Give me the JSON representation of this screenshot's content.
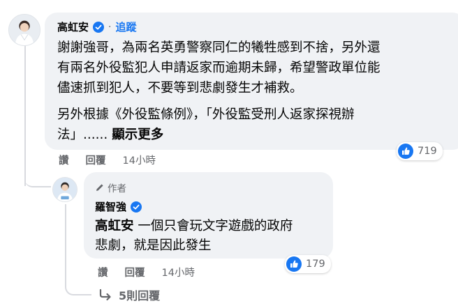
{
  "comment": {
    "author": "高虹安",
    "separator": "·",
    "follow_label": "追蹤",
    "text_lines": [
      "謝謝強哥，為兩名英勇警察同仁的犧牲感到不捨，另外還",
      "有兩名外役監犯人申請返家而逾期未歸，希望警政單位能",
      "儘速抓到犯人，不要等到悲劇發生才補救。"
    ],
    "text_lines_2": [
      "另外根據《外役監條例》，「外役監受刑人返家探視辦",
      "法」......"
    ],
    "see_more": "顯示更多",
    "actions": {
      "like": "讚",
      "reply": "回覆",
      "time": "14小時"
    },
    "reaction_count": "719"
  },
  "reply": {
    "author_badge": "作者",
    "author": "羅智強",
    "mention": "高虹安",
    "text_lines": [
      " 一個只會玩文字遊戲的政府",
      "悲劇，就是因此發生"
    ],
    "actions": {
      "like": "讚",
      "reply": "回覆",
      "time": "14小時"
    },
    "reaction_count": "179"
  },
  "view_replies": "5則回覆",
  "colors": {
    "bubble": "#f0f2f5",
    "link_blue": "#1877f2",
    "secondary_text": "#65676b",
    "like_blue": "#1877f2"
  }
}
